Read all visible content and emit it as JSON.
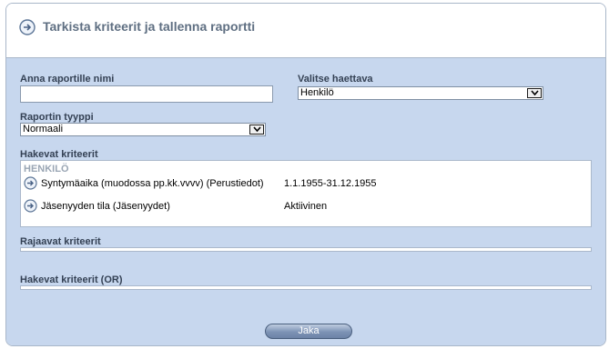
{
  "header": {
    "title": "Tarkista kriteerit ja tallenna raportti"
  },
  "form": {
    "name_label": "Anna raportille nimi",
    "name_value": "",
    "target_label": "Valitse haettava",
    "target_value": "Henkilö",
    "type_label": "Raportin tyyppi",
    "type_value": "Normaali"
  },
  "search_criteria": {
    "label": "Hakevat kriteerit",
    "group": "HENKILÖ",
    "rows": [
      {
        "name": "Syntymäaika (muodossa pp.kk.vvvv) (Perustiedot)",
        "value": "1.1.1955-31.12.1955"
      },
      {
        "name": "Jäsenyyden tila (Jäsenyydet)",
        "value": "Aktiivinen"
      }
    ]
  },
  "limiting_criteria": {
    "label": "Rajaavat kriteerit"
  },
  "or_criteria": {
    "label": "Hakevat kriteerit (OR)"
  },
  "actions": {
    "share_label": "Jaka"
  },
  "colors": {
    "panel_bg": "#c7d7ee",
    "title": "#5f6f82",
    "button": "#7d93b5"
  }
}
